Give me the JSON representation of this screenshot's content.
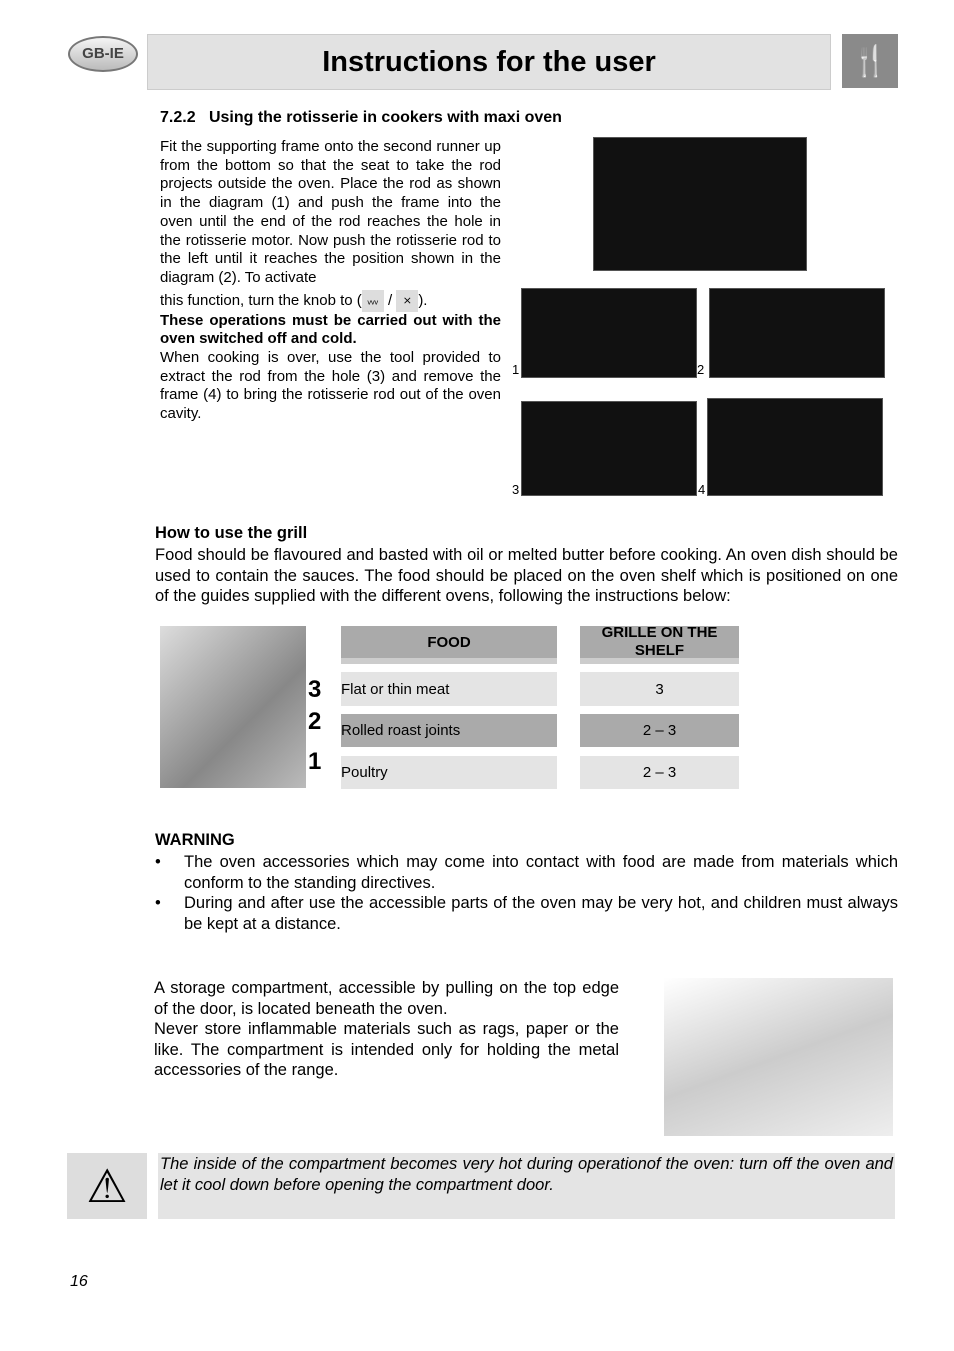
{
  "header": {
    "region_badge": "GB-IE",
    "title": "Instructions for the user"
  },
  "section": {
    "number": "7.2.2",
    "title": "Using the rotisserie in cookers with maxi oven",
    "para1": "Fit the supporting frame onto the second runner up from the bottom so that the seat to take the rod projects outside the oven. Place the rod as shown in the diagram (1) and push the frame into the oven until the end of the rod reaches the hole in the rotisserie motor. Now push the rotisserie rod to the left until it reaches the position shown in the diagram (2). To activate",
    "knob_text": "this function, turn the knob to (",
    "knob_sep": "/",
    "knob_end": ").",
    "bold": "These operations must be carried out with the oven switched off and cold.",
    "para2": "When cooking is over, use the tool provided to extract the rod from the hole (3) and remove the frame (4) to bring the rotisserie rod out of the oven cavity.",
    "figure_labels": [
      "1",
      "2",
      "3",
      "4"
    ]
  },
  "grill": {
    "title": "How to use the grill",
    "text": "Food should be flavoured and basted with oil or melted butter before cooking. An oven dish should be used to contain the sauces. The food should be placed on the oven shelf which is positioned on one of the guides supplied with the different ovens, following the instructions below:",
    "shelf_numbers": [
      "3",
      "2",
      "1"
    ],
    "table": {
      "headers": [
        "FOOD",
        "GRILLE ON THE SHELF"
      ],
      "rows": [
        [
          "Flat or thin meat",
          "3"
        ],
        [
          "Rolled roast joints",
          "2 – 3"
        ],
        [
          "Poultry",
          "2 – 3"
        ]
      ]
    }
  },
  "warning": {
    "title": "WARNING",
    "items": [
      "The oven accessories which may come into contact with food are made from materials which conform to the standing directives.",
      "During and after use the accessible parts of the oven may be very hot, and children must always be kept at a distance."
    ]
  },
  "storage": {
    "p1": "A storage compartment, accessible by pulling on the top edge of the door, is located beneath the oven.",
    "p2": "Never store inflammable materials such as rags, paper or the like. The compartment is intended only for holding the metal accessories of the range."
  },
  "caution": {
    "text": "The inside of the compartment becomes very hot during operationof the oven: turn off the oven and let it cool down before opening the compartment door."
  },
  "footer": {
    "page_number": "16"
  }
}
